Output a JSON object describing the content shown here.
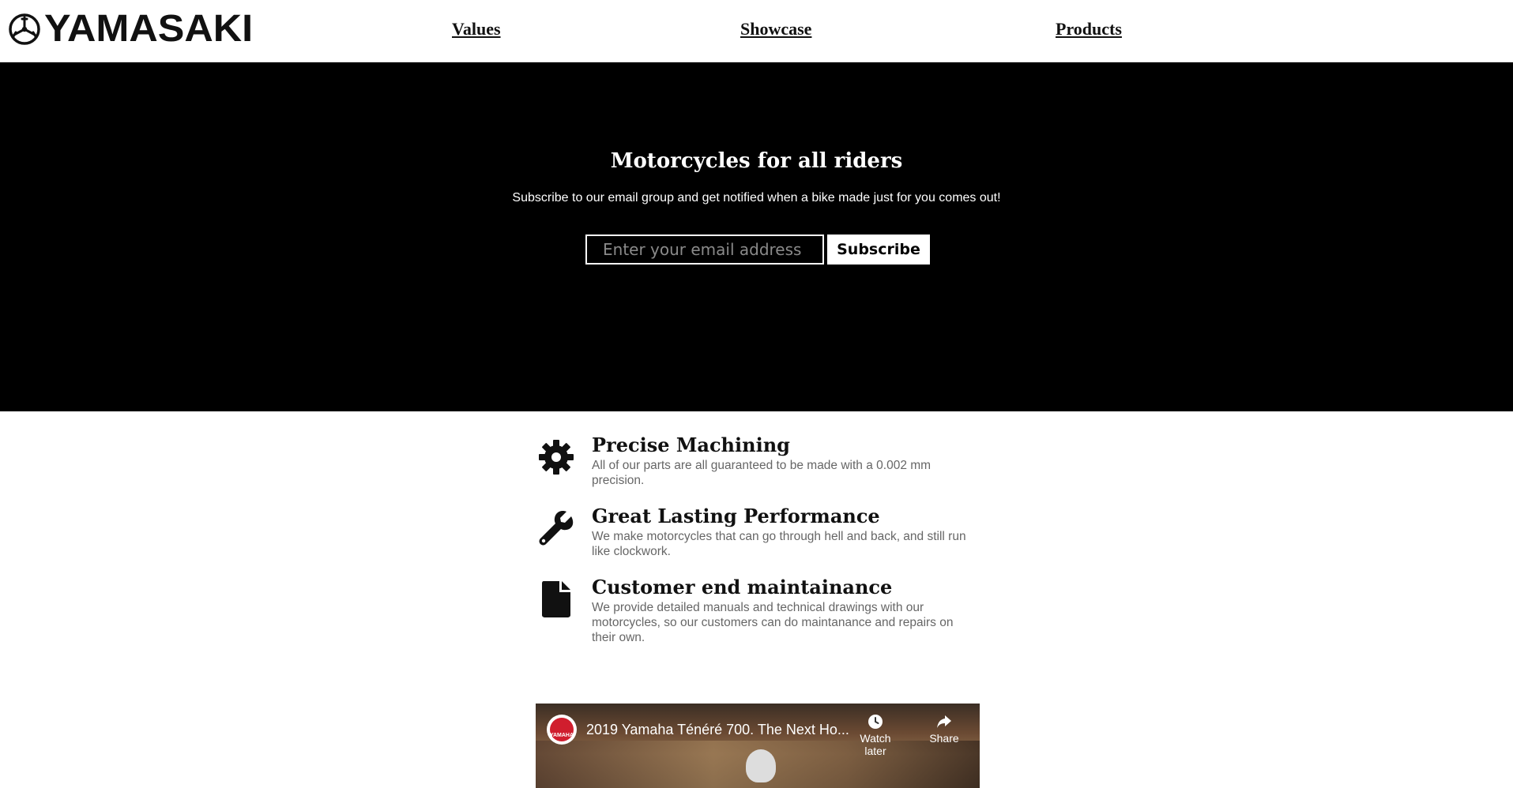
{
  "brand": {
    "name": "YAMASAKI"
  },
  "nav": {
    "values": "Values",
    "showcase": "Showcase",
    "products": "Products"
  },
  "hero": {
    "title": "Motorcycles for all riders",
    "subtitle": "Subscribe to our email group and get notified when a bike made just for you comes out!",
    "email_placeholder": "Enter your email address",
    "subscribe_label": "Subscribe"
  },
  "features": [
    {
      "icon": "gear-icon",
      "title": "Precise Machining",
      "desc": "All of our parts are all guaranteed to be made with a 0.002 mm precision."
    },
    {
      "icon": "wrench-icon",
      "title": "Great Lasting Performance",
      "desc": "We make motorcycles that can go through hell and back, and still run like clockwork."
    },
    {
      "icon": "file-icon",
      "title": "Customer end maintainance",
      "desc": "We provide detailed manuals and technical drawings with our motorcycles, so our customers can do maintanance and repairs on their own."
    }
  ],
  "video": {
    "title": "2019 Yamaha Ténéré 700. The Next Ho...",
    "channel": "YAMAHA",
    "watch_later": "Watch later",
    "share": "Share"
  },
  "colors": {
    "hero_bg": "#000000",
    "text": "#111111",
    "muted": "#666666"
  }
}
